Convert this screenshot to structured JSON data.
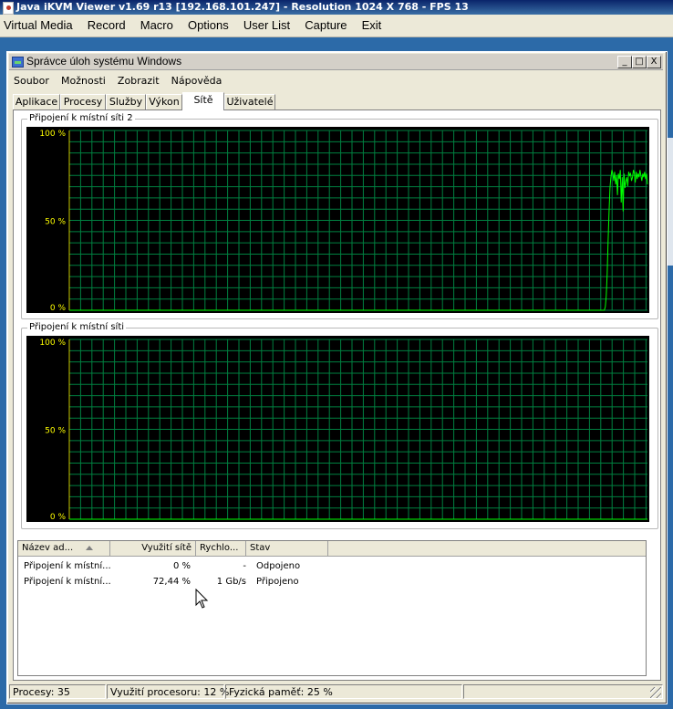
{
  "viewer": {
    "title": "Java iKVM Viewer v1.69 r13 [192.168.101.247]  - Resolution 1024 X 768 - FPS 13",
    "menu": [
      "Virtual Media",
      "Record",
      "Macro",
      "Options",
      "User List",
      "Capture",
      "Exit"
    ]
  },
  "task_manager": {
    "title": "Správce úloh systému Windows",
    "window_buttons": [
      "_",
      "□",
      "X"
    ],
    "menu": [
      "Soubor",
      "Možnosti",
      "Zobrazit",
      "Nápověda"
    ],
    "tabs": [
      {
        "label": "Aplikace",
        "active": false
      },
      {
        "label": "Procesy",
        "active": false
      },
      {
        "label": "Služby",
        "active": false
      },
      {
        "label": "Výkon",
        "active": false
      },
      {
        "label": "Sítě",
        "active": true
      },
      {
        "label": "Uživatelé",
        "active": false
      }
    ]
  },
  "graphs": [
    {
      "label": "Připojení k místní síti 2",
      "ticks": [
        "100 %",
        "50 %",
        "0 %"
      ],
      "line_color": "#00ff00",
      "grid_color": "#008040",
      "utilization_percent": [
        0,
        0,
        0,
        0,
        0,
        0,
        0,
        0,
        0,
        0,
        0,
        0,
        0,
        0,
        0,
        0,
        0,
        0,
        0,
        0,
        0,
        0,
        0,
        0,
        0,
        0,
        0,
        0,
        0,
        0,
        0,
        0,
        0,
        0,
        0,
        0,
        0,
        0,
        0,
        0,
        0,
        0,
        0,
        0,
        0,
        0,
        0,
        0,
        0,
        0,
        0,
        0,
        0,
        0,
        0,
        0,
        0,
        0,
        0,
        0,
        0,
        0,
        0,
        0,
        0,
        0,
        0,
        0,
        0,
        0,
        0,
        0,
        0,
        0,
        0,
        0,
        0,
        0,
        0,
        0,
        0,
        0,
        0,
        0,
        0,
        0,
        0,
        0,
        0,
        0,
        0,
        0,
        0,
        0,
        0,
        0,
        0,
        0,
        0,
        0,
        0,
        0,
        0,
        0,
        0,
        0,
        0,
        0,
        0,
        0,
        0,
        0,
        0,
        0,
        0,
        0,
        0,
        0,
        0,
        0,
        0,
        0,
        0,
        0,
        0,
        0,
        0,
        0,
        0,
        0,
        0,
        0,
        0,
        0,
        0,
        0,
        0,
        0,
        0,
        0,
        0,
        0,
        0,
        0,
        0,
        0,
        0,
        0,
        0,
        0,
        0,
        0,
        0,
        0,
        0,
        0,
        0,
        0,
        0,
        0,
        0,
        0,
        0,
        0,
        0,
        0,
        0,
        0,
        0,
        0,
        0,
        0,
        0,
        0,
        0,
        0,
        0,
        0,
        0,
        0,
        0,
        0,
        0,
        0,
        0,
        0,
        0,
        0,
        0,
        0,
        0,
        0,
        0,
        0,
        0,
        0,
        0,
        0,
        0,
        0,
        0,
        0,
        0,
        0,
        0,
        0,
        0,
        0,
        0,
        0,
        0,
        0,
        0,
        0,
        0,
        0,
        0,
        0,
        0,
        0,
        0,
        0,
        0,
        0,
        0,
        0,
        0,
        0,
        0,
        0,
        0,
        0,
        0,
        0,
        0,
        0,
        0,
        0,
        0,
        0,
        0,
        0,
        0,
        0,
        0,
        0,
        0,
        0,
        0,
        0,
        0,
        0,
        0,
        0,
        0,
        0,
        0,
        0,
        0,
        0,
        0,
        0,
        0,
        0,
        0,
        0,
        0,
        0,
        0,
        0,
        0,
        0,
        0,
        0,
        0,
        0,
        0,
        0,
        0,
        0,
        0,
        0,
        0,
        0,
        0,
        0,
        0,
        0,
        0,
        0,
        0,
        0,
        0,
        0,
        0,
        0,
        0,
        0,
        0,
        0,
        0,
        0,
        0,
        0,
        0,
        0,
        0,
        0,
        0,
        0,
        0,
        0,
        0,
        0,
        0,
        0,
        0,
        0,
        0,
        0,
        0,
        0,
        0,
        0,
        0,
        0,
        0,
        0,
        0,
        0,
        0,
        0,
        0,
        0,
        0,
        0,
        0,
        0,
        0,
        0,
        0,
        0,
        0,
        0,
        0,
        0,
        0,
        0,
        0,
        0,
        0,
        0,
        0,
        0,
        0,
        0,
        0,
        0,
        0,
        0,
        0,
        0,
        0,
        0,
        0,
        0,
        0,
        0,
        0,
        0,
        0,
        0,
        0,
        0,
        0,
        0,
        0,
        0,
        0,
        0,
        0,
        0,
        0,
        0,
        0,
        0,
        0,
        0,
        0,
        0,
        0,
        0,
        0,
        0,
        0,
        0,
        0,
        0,
        0,
        0,
        0,
        0,
        0,
        0,
        0,
        0,
        0,
        0,
        0,
        0,
        0,
        0,
        0,
        0,
        0,
        0,
        0,
        0,
        0,
        0,
        0,
        0,
        0,
        0,
        0,
        0,
        0,
        0,
        0,
        0,
        0,
        0,
        0,
        0,
        0,
        0,
        0,
        0,
        0,
        0,
        0,
        0,
        0,
        0,
        0,
        0,
        0,
        0,
        0,
        0,
        0,
        0,
        0,
        0,
        0,
        0,
        0,
        0,
        0,
        0,
        0,
        0,
        0,
        0,
        0,
        0,
        0,
        0,
        0,
        0,
        0,
        0,
        0,
        0,
        0,
        0,
        0,
        0,
        0,
        0,
        0,
        0,
        0,
        0,
        0,
        0,
        0,
        0,
        0,
        0,
        0,
        0,
        0,
        0,
        0,
        0,
        0,
        0,
        0,
        0,
        0,
        0,
        0,
        0,
        0,
        0,
        0,
        0,
        0,
        0,
        0,
        0,
        0,
        0,
        0,
        0,
        0,
        0,
        0,
        0,
        0,
        0,
        0,
        0,
        0,
        0,
        0,
        0,
        0,
        0,
        0,
        0,
        0,
        0,
        0,
        0,
        0,
        0,
        0,
        0,
        0,
        0,
        0,
        0,
        0,
        0,
        0,
        0,
        0,
        0,
        0,
        0,
        0,
        0,
        0,
        0,
        0,
        0,
        0,
        0,
        0,
        0,
        0,
        0,
        0,
        0,
        0,
        0,
        0,
        0,
        0,
        0,
        2,
        8,
        20,
        38,
        55,
        68,
        74,
        78,
        76,
        72,
        77,
        70,
        75,
        64,
        76,
        73,
        78,
        60,
        74,
        55,
        76,
        68,
        72,
        74,
        69,
        77,
        75,
        76,
        72,
        74,
        78,
        76,
        71,
        77,
        73,
        76,
        74,
        78,
        75,
        72,
        76,
        74,
        77,
        73,
        76,
        70
      ]
    },
    {
      "label": "Připojení k místní síti",
      "ticks": [
        "100 %",
        "50 %",
        "0 %"
      ],
      "line_color": "#00ff00",
      "grid_color": "#008040",
      "utilization_percent": [
        0,
        0,
        0,
        0,
        0,
        0,
        0,
        0,
        0,
        0,
        0,
        0,
        0,
        0,
        0,
        0,
        0,
        0,
        0,
        0,
        0,
        0,
        0,
        0,
        0,
        0,
        0,
        0,
        0,
        0,
        0,
        0,
        0,
        0,
        0,
        0,
        0,
        0,
        0,
        0,
        0,
        0,
        0,
        0,
        0,
        0,
        0,
        0,
        0,
        0,
        0,
        0,
        0,
        0,
        0,
        0,
        0,
        0,
        0,
        0,
        0,
        0,
        0,
        0,
        0,
        0,
        0,
        0,
        0,
        0,
        0,
        0,
        0,
        0,
        0,
        0,
        0,
        0,
        0,
        0,
        0,
        0,
        0,
        0,
        0,
        0,
        0,
        0,
        0,
        0,
        0,
        0,
        0,
        0,
        0,
        0,
        0,
        0,
        0,
        0,
        0,
        0,
        0,
        0,
        0,
        0,
        0,
        0,
        0,
        0,
        0,
        0,
        0,
        0,
        0,
        0,
        0,
        0,
        0,
        0,
        0,
        0,
        0,
        0,
        0,
        0,
        0,
        0,
        0,
        0,
        0,
        0,
        0,
        0,
        0,
        0,
        0,
        0,
        0,
        0,
        0,
        0,
        0,
        0,
        0,
        0,
        0,
        0,
        0,
        0,
        0,
        0,
        0,
        0,
        0,
        0,
        0,
        0,
        0,
        0,
        0,
        0,
        0,
        0,
        0,
        0,
        0,
        0,
        0,
        0,
        0,
        0,
        0,
        0,
        0,
        0,
        0,
        0,
        0,
        0,
        0,
        0,
        0,
        0,
        0,
        0,
        0,
        0,
        0,
        0,
        0,
        0,
        0,
        0,
        0,
        0,
        0,
        0,
        0,
        0,
        0,
        0,
        0,
        0,
        0,
        0,
        0,
        0,
        0,
        0,
        0,
        0,
        0,
        0,
        0,
        0,
        0,
        0,
        0,
        0,
        0,
        0,
        0,
        0,
        0,
        0,
        0,
        0,
        0,
        0,
        0,
        0,
        0,
        0,
        0,
        0,
        0,
        0,
        0,
        0,
        0,
        0,
        0,
        0,
        0,
        0,
        0,
        0,
        0,
        0,
        0,
        0,
        0,
        0,
        0,
        0,
        0,
        0,
        0,
        0,
        0,
        0,
        0,
        0,
        0,
        0,
        0,
        0,
        0,
        0,
        0,
        0,
        0,
        0,
        0,
        0,
        0,
        0,
        0,
        0,
        0,
        0,
        0,
        0,
        0,
        0,
        0,
        0,
        0,
        0,
        0,
        0,
        0,
        0,
        0,
        0,
        0,
        0,
        0,
        0,
        0,
        0,
        0,
        0,
        0,
        0,
        0,
        0,
        0,
        0,
        0,
        0,
        0,
        0,
        0,
        0,
        0,
        0,
        0,
        0,
        0,
        0,
        0,
        0,
        0,
        0,
        0,
        0,
        0,
        0,
        0,
        0,
        0,
        0,
        0,
        0,
        0,
        0,
        0,
        0,
        0,
        0,
        0,
        0,
        0,
        0,
        0,
        0,
        0,
        0,
        0,
        0,
        0,
        0,
        0,
        0,
        0,
        0,
        0,
        0,
        0,
        0,
        0,
        0,
        0,
        0,
        0,
        0,
        0,
        0,
        0,
        0,
        0,
        0,
        0,
        0,
        0,
        0,
        0,
        0,
        0,
        0,
        0,
        0,
        0,
        0,
        0,
        0,
        0,
        0,
        0,
        0,
        0,
        0,
        0,
        0,
        0,
        0,
        0,
        0,
        0,
        0,
        0,
        0,
        0,
        0,
        0,
        0,
        0,
        0,
        0,
        0,
        0,
        0,
        0,
        0,
        0,
        0,
        0,
        0,
        0,
        0,
        0,
        0,
        0,
        0,
        0,
        0,
        0,
        0,
        0,
        0,
        0,
        0,
        0,
        0,
        0,
        0,
        0,
        0,
        0,
        0,
        0,
        0,
        0,
        0,
        0,
        0,
        0,
        0,
        0,
        0,
        0,
        0,
        0,
        0,
        0,
        0,
        0,
        0,
        0,
        0,
        0,
        0,
        0,
        0,
        0,
        0,
        0,
        0,
        0,
        0,
        0,
        0,
        0,
        0,
        0,
        0,
        0,
        0,
        0,
        0,
        0,
        0,
        0,
        0,
        0,
        0,
        0,
        0,
        0,
        0,
        0,
        0,
        0,
        0,
        0,
        0,
        0,
        0,
        0,
        0,
        0,
        0,
        0,
        0,
        0,
        0,
        0,
        0,
        0,
        0,
        0,
        0,
        0,
        0,
        0,
        0,
        0,
        0,
        0,
        0,
        0,
        0,
        0,
        0,
        0,
        0,
        0,
        0,
        0,
        0,
        0,
        0,
        0,
        0,
        0,
        0,
        0,
        0,
        0,
        0,
        0,
        0,
        0,
        0,
        0,
        0,
        0,
        0,
        0,
        0,
        0,
        0,
        0,
        0,
        0,
        0,
        0,
        0,
        0,
        0,
        0,
        0,
        0,
        0,
        0,
        0,
        0,
        0,
        0,
        0,
        0,
        0,
        0,
        0,
        0,
        0,
        0,
        0,
        0,
        0,
        0,
        0,
        0,
        0,
        0,
        0,
        0,
        0,
        0,
        0,
        0,
        0,
        0,
        0,
        0,
        0,
        0,
        0,
        0,
        0,
        0,
        0,
        0,
        0,
        0,
        0,
        0,
        0,
        0,
        0,
        0,
        0,
        0,
        0,
        0,
        0,
        0,
        0,
        0,
        0,
        0,
        0,
        0,
        0,
        0,
        0,
        0,
        0,
        0,
        0,
        0,
        0,
        0,
        0,
        0,
        0,
        0,
        0,
        0,
        0,
        0,
        0,
        0,
        0,
        0,
        0,
        0,
        0,
        0,
        0,
        0,
        0,
        0,
        0,
        0,
        0,
        0,
        0,
        0,
        0,
        0,
        0,
        0,
        0,
        0,
        0,
        0,
        0,
        0,
        0,
        0,
        0,
        0,
        0,
        0,
        0,
        0,
        0,
        0,
        0,
        0,
        0,
        0,
        0,
        0,
        0,
        0,
        0,
        0,
        0,
        0,
        0,
        0,
        0,
        0,
        0,
        0,
        0,
        0,
        0,
        0,
        0,
        0,
        0,
        0,
        0,
        0,
        0,
        0,
        0,
        0,
        0,
        0,
        0,
        0,
        0,
        0,
        0,
        0,
        0,
        0,
        0,
        0,
        0,
        0,
        0,
        0,
        0,
        0,
        0,
        0,
        0,
        0,
        0,
        0,
        0,
        0,
        0,
        0,
        0,
        0,
        0,
        0,
        0,
        0,
        0,
        0,
        0,
        0,
        0,
        0,
        0,
        0,
        0,
        0,
        0,
        0,
        0,
        0,
        0,
        0,
        0,
        0,
        0,
        0,
        0,
        0,
        0,
        0,
        0,
        0,
        0,
        0,
        0,
        0,
        0,
        0,
        0,
        0,
        0,
        0,
        0,
        0,
        0,
        0,
        0,
        0,
        0,
        0,
        0,
        0,
        0,
        0,
        0,
        0,
        0,
        0,
        0,
        0,
        0,
        0,
        0,
        0,
        0,
        0,
        0,
        0,
        0,
        0,
        0,
        0,
        0,
        0,
        0,
        0,
        0,
        0,
        0,
        0,
        0,
        0
      ]
    }
  ],
  "adapter_list": {
    "columns": [
      "Název ad...",
      "Využití sítě",
      "Rychlo...",
      "Stav"
    ],
    "rows": [
      {
        "name": "Připojení k místní...",
        "utilization": "0 %",
        "speed": "-",
        "state": "Odpojeno"
      },
      {
        "name": "Připojení k místní...",
        "utilization": "72,44 %",
        "speed": "1 Gb/s",
        "state": "Připojeno"
      }
    ]
  },
  "status_bar": {
    "processes": "Procesy: 35",
    "cpu": "Využití procesoru: 12 %",
    "memory": "Fyzická paměť: 25 %"
  }
}
